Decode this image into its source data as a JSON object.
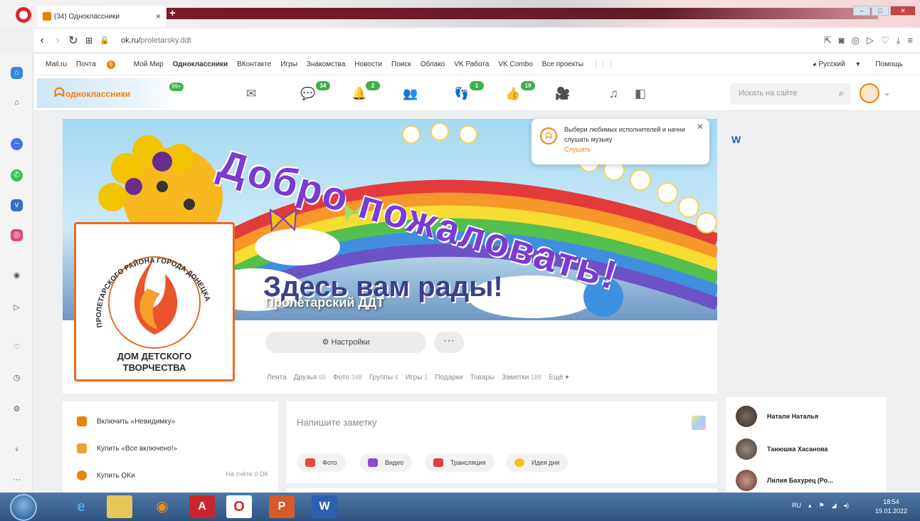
{
  "browser": {
    "tab_title": "(34) Одноклассники",
    "url_domain": "ok.ru/",
    "url_path": "proletarsky.ddt",
    "window_controls": [
      "–",
      "□",
      "✕"
    ]
  },
  "services": {
    "items": [
      "Mail.ru",
      "Почта",
      "Мой Мир",
      "Одноклассники",
      "ВКонтакте",
      "Игры",
      "Знакомства",
      "Новости",
      "Поиск",
      "Облако",
      "VK Работа",
      "VK Combo",
      "Все проекты"
    ],
    "mail_badge": "6",
    "language": "Русский",
    "help": "Помощь"
  },
  "toolbar": {
    "logo_text": "одноклассники",
    "logo_badge": "99+",
    "discussions_badge": "34",
    "notifications_badge": "2",
    "guests_badge": "1",
    "likes_badge": "19",
    "search_placeholder": "Искать на сайте",
    "icons": [
      "mail-icon",
      "discussions-icon",
      "bell-icon",
      "friends-icon",
      "guests-icon",
      "like-icon",
      "video-icon",
      "music-icon"
    ]
  },
  "popup": {
    "text": "Выбери любимых исполнителей и начни слушать музыку",
    "link": "Слушать"
  },
  "banner": {
    "welcome": "Добро пожаловать!",
    "subtitle": "Здесь вам рады!"
  },
  "profile": {
    "name": "Пролетарский ДДТ",
    "logo_ring_text": "ПРОЛЕТАРСКОГО РАЙОНА ГОРОДА ДОНЕЦКА",
    "logo_bottom_1": "ДОМ ДЕТСКОГО",
    "logo_bottom_2": "ТВОРЧЕСТВА",
    "settings_label": "Настройки",
    "more_label": "···",
    "nav": [
      {
        "label": "Лента",
        "count": ""
      },
      {
        "label": "Друзья",
        "count": "65"
      },
      {
        "label": "Фото",
        "count": "348"
      },
      {
        "label": "Группы",
        "count": "6"
      },
      {
        "label": "Игры",
        "count": "1"
      },
      {
        "label": "Подарки",
        "count": ""
      },
      {
        "label": "Товары",
        "count": ""
      },
      {
        "label": "Заметки",
        "count": "188"
      },
      {
        "label": "Ещё ▾",
        "count": ""
      }
    ]
  },
  "left_menu": {
    "items": [
      "Включить «Невидимку»",
      "Купить «Все включено!»",
      "Купить ОКи"
    ],
    "balance": "На счёте 0 ОК"
  },
  "composer": {
    "placeholder": "Напишите заметку",
    "buttons": [
      "Фото",
      "Видео",
      "Трансляция",
      "Идея дня"
    ]
  },
  "right": {
    "vk_mark": "W",
    "friends": [
      "Натали Наталья",
      "Танюшка Хасанова",
      "Лилия Бахурец (Ро..."
    ]
  },
  "taskbar": {
    "language": "RU",
    "time": "18:54",
    "date": "19.01.2022"
  },
  "colors": {
    "ok_orange": "#ee8208",
    "badge_green": "#3db147",
    "opera_red": "#e0252a"
  }
}
